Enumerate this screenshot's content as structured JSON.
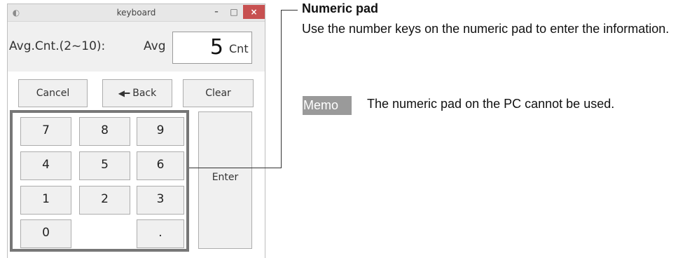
{
  "window": {
    "title": "keyboard",
    "app_icon": "app-icon",
    "minimize_glyph": "–",
    "maximize_glyph": "□",
    "close_glyph": "×"
  },
  "avg": {
    "label": "Avg.Cnt.(2~10):",
    "unit_left": "Avg",
    "value": "5",
    "unit_right": "Cnt"
  },
  "buttons": {
    "cancel": "Cancel",
    "back": "Back",
    "back_icon": "left-arrow-icon",
    "clear": "Clear",
    "enter": "Enter"
  },
  "keypad": [
    "7",
    "8",
    "9",
    "4",
    "5",
    "6",
    "1",
    "2",
    "3",
    "0",
    "."
  ],
  "callout": {
    "heading": "Numeric pad",
    "body": "Use the number keys on the numeric pad to enter the information."
  },
  "memo": {
    "tag": "Memo",
    "text": "The numeric pad on the PC cannot be used."
  },
  "colors": {
    "close_button": "#c75050",
    "memo_tag": "#9a9a9a",
    "keypad_frame": "#777777"
  }
}
